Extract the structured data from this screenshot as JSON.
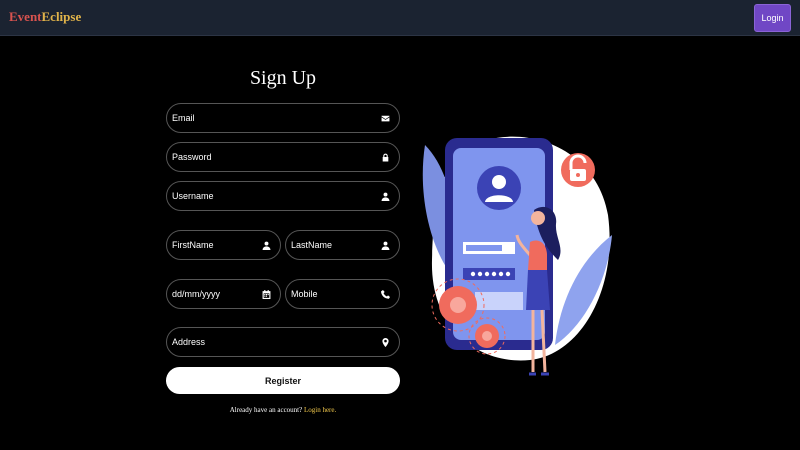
{
  "navbar": {
    "brand_part1": "Event",
    "brand_part2": "Eclipse",
    "login_label": "Login"
  },
  "form": {
    "title": "Sign Up",
    "email_placeholder": "Email",
    "password_placeholder": "Password",
    "username_placeholder": "Username",
    "firstname_placeholder": "FirstName",
    "lastname_placeholder": "LastName",
    "date_placeholder": "dd/mm/yyyy",
    "mobile_placeholder": "Mobile",
    "address_placeholder": "Address",
    "register_label": "Register",
    "already_text": "Already have an account?",
    "login_link": "Login here."
  },
  "icons": {
    "email": "envelope-icon",
    "password": "lock-icon",
    "username": "user-icon",
    "firstname": "user-icon",
    "lastname": "user-icon",
    "date": "calendar-icon",
    "mobile": "phone-icon",
    "address": "map-marker-icon"
  },
  "colors": {
    "brand_red": "#d9534f",
    "brand_gold": "#e0b34a",
    "login_button": "#7047c5",
    "link": "#f2c94c",
    "navbar": "#1b2331"
  }
}
